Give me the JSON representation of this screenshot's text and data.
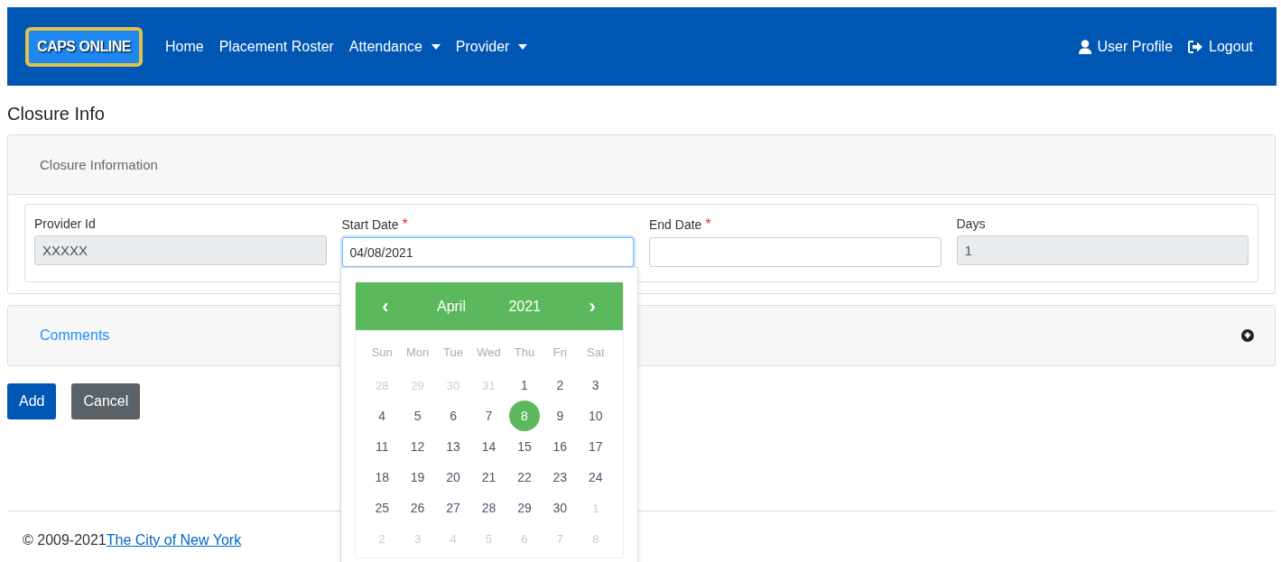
{
  "navbar": {
    "logo": "CAPS ONLINE",
    "links": [
      {
        "label": "Home",
        "dropdown": false
      },
      {
        "label": "Placement Roster",
        "dropdown": false
      },
      {
        "label": "Attendance",
        "dropdown": true
      },
      {
        "label": "Provider",
        "dropdown": true
      }
    ],
    "right_links": [
      {
        "label": "User Profile",
        "kind": "user"
      },
      {
        "label": "Logout",
        "kind": "logout"
      }
    ]
  },
  "page_title": "Closure Info",
  "card": {
    "header": "Closure Information",
    "required_mark": "*",
    "fields": [
      {
        "label": "Provider Id",
        "required": false,
        "value": "XXXXX",
        "disabled": true,
        "focused": false
      },
      {
        "label": "Start Date",
        "required": true,
        "value": "04/08/2021",
        "disabled": false,
        "focused": true
      },
      {
        "label": "End Date",
        "required": true,
        "disabled": false,
        "focused": false
      },
      {
        "label": "Days",
        "required": false,
        "value": "1",
        "disabled": true,
        "focused": false
      }
    ]
  },
  "comments": {
    "label": "Comments",
    "expanded": false
  },
  "buttons": [
    {
      "label": "Add",
      "kind": "primary"
    },
    {
      "label": "Cancel",
      "kind": "secondary"
    }
  ],
  "datepicker": {
    "prev": "‹",
    "month": "April",
    "year": "2021",
    "next": "›",
    "weekdays": [
      "Sun",
      "Mon",
      "Tue",
      "Wed",
      "Thu",
      "Fri",
      "Sat"
    ],
    "weeks": [
      [
        {
          "day": "28",
          "muted": true,
          "selected": false
        },
        {
          "day": "29",
          "muted": true,
          "selected": false
        },
        {
          "day": "30",
          "muted": true,
          "selected": false
        },
        {
          "day": "31",
          "muted": true,
          "selected": false
        },
        {
          "day": "1",
          "muted": false,
          "selected": false
        },
        {
          "day": "2",
          "muted": false,
          "selected": false
        },
        {
          "day": "3",
          "muted": false,
          "selected": false
        }
      ],
      [
        {
          "day": "4",
          "muted": false,
          "selected": false
        },
        {
          "day": "5",
          "muted": false,
          "selected": false
        },
        {
          "day": "6",
          "muted": false,
          "selected": false
        },
        {
          "day": "7",
          "muted": false,
          "selected": false
        },
        {
          "day": "8",
          "muted": false,
          "selected": true
        },
        {
          "day": "9",
          "muted": false,
          "selected": false
        },
        {
          "day": "10",
          "muted": false,
          "selected": false
        }
      ],
      [
        {
          "day": "11",
          "muted": false,
          "selected": false
        },
        {
          "day": "12",
          "muted": false,
          "selected": false
        },
        {
          "day": "13",
          "muted": false,
          "selected": false
        },
        {
          "day": "14",
          "muted": false,
          "selected": false
        },
        {
          "day": "15",
          "muted": false,
          "selected": false
        },
        {
          "day": "16",
          "muted": false,
          "selected": false
        },
        {
          "day": "17",
          "muted": false,
          "selected": false
        }
      ],
      [
        {
          "day": "18",
          "muted": false,
          "selected": false
        },
        {
          "day": "19",
          "muted": false,
          "selected": false
        },
        {
          "day": "20",
          "muted": false,
          "selected": false
        },
        {
          "day": "21",
          "muted": false,
          "selected": false
        },
        {
          "day": "22",
          "muted": false,
          "selected": false
        },
        {
          "day": "23",
          "muted": false,
          "selected": false
        },
        {
          "day": "24",
          "muted": false,
          "selected": false
        }
      ],
      [
        {
          "day": "25",
          "muted": false,
          "selected": false
        },
        {
          "day": "26",
          "muted": false,
          "selected": false
        },
        {
          "day": "27",
          "muted": false,
          "selected": false
        },
        {
          "day": "28",
          "muted": false,
          "selected": false
        },
        {
          "day": "29",
          "muted": false,
          "selected": false
        },
        {
          "day": "30",
          "muted": false,
          "selected": false
        },
        {
          "day": "1",
          "muted": true,
          "selected": false
        }
      ],
      [
        {
          "day": "2",
          "muted": true,
          "selected": false
        },
        {
          "day": "3",
          "muted": true,
          "selected": false
        },
        {
          "day": "4",
          "muted": true,
          "selected": false
        },
        {
          "day": "5",
          "muted": true,
          "selected": false
        },
        {
          "day": "6",
          "muted": true,
          "selected": false
        },
        {
          "day": "7",
          "muted": true,
          "selected": false
        },
        {
          "day": "8",
          "muted": true,
          "selected": false
        }
      ]
    ]
  },
  "footer": {
    "copyright": "© 2009-2021",
    "link": "The City of New York"
  }
}
